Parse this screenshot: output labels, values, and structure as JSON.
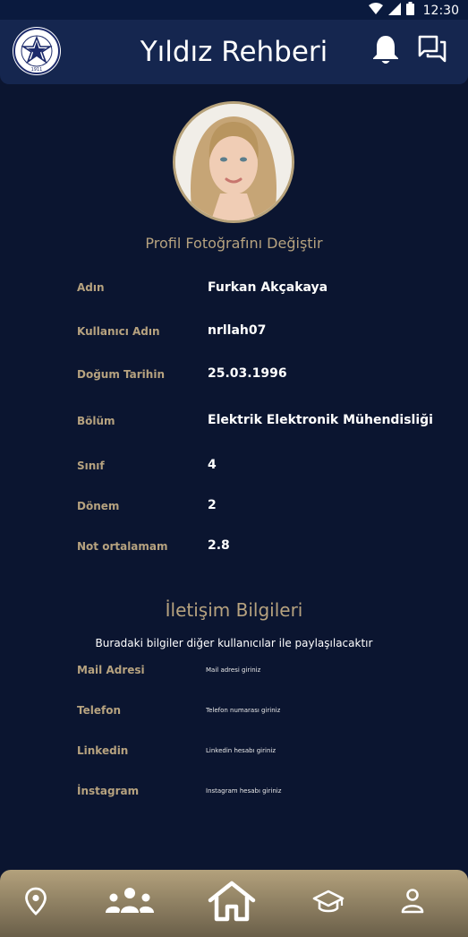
{
  "status_bar": {
    "time": "12:30"
  },
  "app_bar": {
    "title": "Yıldız Rehberi",
    "logo_year": "1911"
  },
  "profile": {
    "change_photo_label": "Profil Fotoğrafını Değiştir",
    "fields": [
      {
        "label": "Adın",
        "value": "Furkan Akçakaya"
      },
      {
        "label": "Kullanıcı Adın",
        "value": "nrllah07"
      },
      {
        "label": "Doğum Tarihin",
        "value": "25.03.1996"
      },
      {
        "label": "Bölüm",
        "value": "Elektrik Elektronik Mühendisliği"
      },
      {
        "label": "Sınıf",
        "value": "4"
      },
      {
        "label": "Dönem",
        "value": "2"
      },
      {
        "label": "Not ortalamam",
        "value": "2.8"
      }
    ]
  },
  "contact": {
    "title": "İletişim Bilgileri",
    "subtitle": "Buradaki bilgiler diğer kullanıcılar ile paylaşılacaktır",
    "fields": [
      {
        "label": "Mail Adresi",
        "placeholder": "Mail adresi giriniz"
      },
      {
        "label": "Telefon",
        "placeholder": "Telefon numarası giriniz"
      },
      {
        "label": "Linkedin",
        "placeholder": "Linkedin hesabı giriniz"
      },
      {
        "label": "İnstagram",
        "placeholder": "İnstagram hesabı giriniz"
      }
    ]
  },
  "bottom_nav": {
    "items": [
      {
        "icon": "map-pin-icon"
      },
      {
        "icon": "people-icon"
      },
      {
        "icon": "home-icon"
      },
      {
        "icon": "graduation-cap-icon"
      },
      {
        "icon": "user-icon"
      }
    ]
  },
  "colors": {
    "background": "#0b1530",
    "appbar": "#15264f",
    "accent_gold": "#b6a27f",
    "text": "#ffffff"
  }
}
